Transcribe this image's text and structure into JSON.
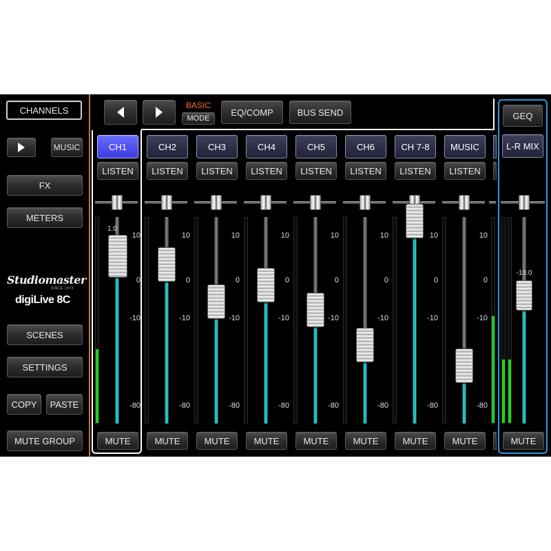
{
  "sidebar": {
    "channels_label": "CHANNELS",
    "music_label": "MUSIC",
    "fx_label": "FX",
    "meters_label": "METERS",
    "scenes_label": "SCENES",
    "settings_label": "SETTINGS",
    "copy_label": "COPY",
    "paste_label": "PASTE",
    "mute_group_label": "MUTE GROUP",
    "brand_name": "Studiomaster",
    "brand_tagline": "SINCE 1973",
    "product_name": "digiLive 8C"
  },
  "toolbar": {
    "basic_label": "BASIC",
    "mode_label": "MODE",
    "eq_comp_label": "EQ/COMP",
    "bus_send_label": "BUS SEND",
    "geq_label": "GEQ"
  },
  "scale": {
    "plus10": "10",
    "zero": "0",
    "minus10": "-10",
    "minus80": "-80"
  },
  "colors": {
    "selected_channel": "#4a4cf0",
    "fader_track": "#19c2c2",
    "meter": "#1fd11f",
    "basic_text": "#ff6a2a",
    "selection_outline": "#ffffff",
    "master_outline": "#2a9ad8"
  },
  "channels": [
    {
      "name": "CH1",
      "listen": "LISTEN",
      "mute": "MUTE",
      "level": 0.81,
      "readout": "1.0",
      "meter": 0.36,
      "selected": true
    },
    {
      "name": "CH2",
      "listen": "LISTEN",
      "mute": "MUTE",
      "level": 0.77,
      "readout": "",
      "meter": 0,
      "selected": false
    },
    {
      "name": "CH3",
      "listen": "LISTEN",
      "mute": "MUTE",
      "level": 0.59,
      "readout": "",
      "meter": 0,
      "selected": false
    },
    {
      "name": "CH4",
      "listen": "LISTEN",
      "mute": "MUTE",
      "level": 0.67,
      "readout": "",
      "meter": 0,
      "selected": false
    },
    {
      "name": "CH5",
      "listen": "LISTEN",
      "mute": "MUTE",
      "level": 0.55,
      "readout": "",
      "meter": 0,
      "selected": false
    },
    {
      "name": "CH6",
      "listen": "LISTEN",
      "mute": "MUTE",
      "level": 0.38,
      "readout": "",
      "meter": 0,
      "selected": false
    },
    {
      "name": "CH 7-8",
      "listen": "LISTEN",
      "mute": "MUTE",
      "level": 0.98,
      "readout": "",
      "meter": 0,
      "selected": false
    },
    {
      "name": "MUSIC",
      "listen": "LISTEN",
      "mute": "MUTE",
      "level": 0.28,
      "readout": "",
      "meter": 0,
      "selected": false
    }
  ],
  "master": {
    "name": "L-R MIX",
    "mute": "MUTE",
    "level": 0.62,
    "readout": "-10.0",
    "meter_left": 0.31,
    "meter_right": 0.31,
    "meter_prev": 0.52
  }
}
